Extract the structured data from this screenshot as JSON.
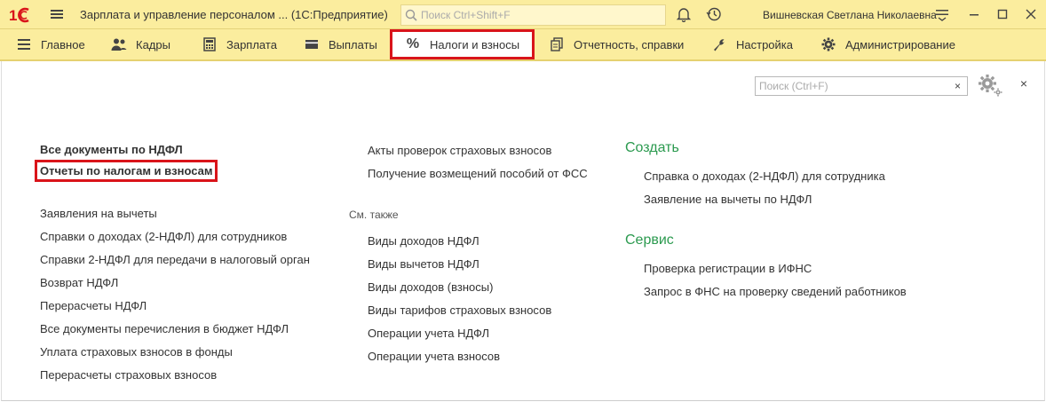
{
  "titlebar": {
    "app_title": "Зарплата и управление персоналом ...  (1С:Предприятие)",
    "search_placeholder": "Поиск Ctrl+Shift+F",
    "user_name": "Вишневская Светлана Николаевна"
  },
  "sections": [
    {
      "label": "Главное",
      "icon": "menu-icon"
    },
    {
      "label": "Кадры",
      "icon": "people-icon"
    },
    {
      "label": "Зарплата",
      "icon": "calculator-icon"
    },
    {
      "label": "Выплаты",
      "icon": "wallet-icon"
    },
    {
      "label": "Налоги и взносы",
      "icon": "percent-icon",
      "active": true
    },
    {
      "label": "Отчетность, справки",
      "icon": "documents-icon"
    },
    {
      "label": "Настройка",
      "icon": "wrench-icon"
    },
    {
      "label": "Администрирование",
      "icon": "gear-icon"
    }
  ],
  "content": {
    "search_placeholder": "Поиск (Ctrl+F)",
    "clear_label": "×",
    "close_label": "×",
    "col1": {
      "top_links": [
        "Все документы по НДФЛ",
        "Отчеты по налогам и взносам"
      ],
      "links": [
        "Заявления на вычеты",
        "Справки о доходах (2-НДФЛ) для сотрудников",
        "Справки 2-НДФЛ для передачи в налоговый орган",
        "Возврат НДФЛ",
        "Перерасчеты НДФЛ",
        "Все документы перечисления в бюджет НДФЛ",
        "Уплата страховых взносов в фонды",
        "Перерасчеты страховых взносов"
      ]
    },
    "col2": {
      "links": [
        "Акты проверок страховых взносов",
        "Получение возмещений пособий от ФСС"
      ],
      "see_also_label": "См. также",
      "see_also": [
        "Виды доходов НДФЛ",
        "Виды вычетов НДФЛ",
        "Виды доходов (взносы)",
        "Виды тарифов страховых взносов",
        "Операции учета НДФЛ",
        "Операции учета взносов"
      ]
    },
    "col3": {
      "create_label": "Создать",
      "create": [
        "Справка о доходах (2-НДФЛ) для сотрудника",
        "Заявление на вычеты по НДФЛ"
      ],
      "service_label": "Сервис",
      "service": [
        "Проверка регистрации в ИФНС",
        "Запрос в ФНС на проверку сведений работников"
      ]
    }
  }
}
